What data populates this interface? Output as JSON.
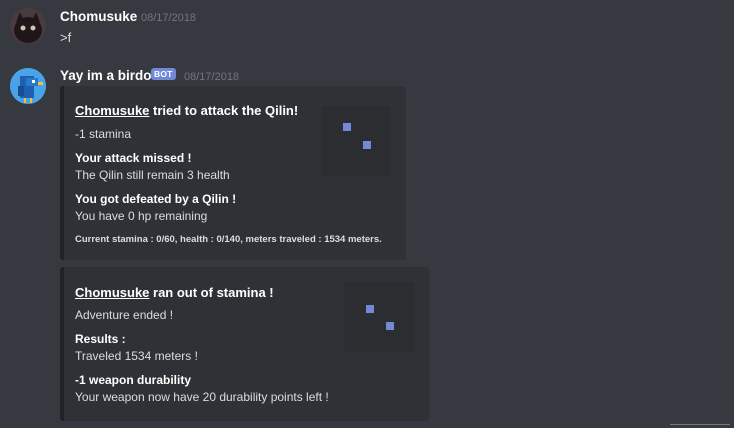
{
  "messages": [
    {
      "username": "Chomusuke",
      "timestamp": "08/17/2018",
      "text": ">f"
    },
    {
      "username": "Yay im a birdo",
      "bot_tag": "BOT",
      "timestamp": "08/17/2018",
      "embeds": [
        {
          "title_user": "Chomusuke",
          "title_rest": " tried to attack the Qilin!",
          "description": "-1 stamina",
          "fields": [
            {
              "name": "Your attack missed !",
              "value": "The Qilin still remain 3 health"
            },
            {
              "name": "You got defeated by a Qilin !",
              "value": "You have 0 hp remaining"
            }
          ],
          "footer": "Current stamina : 0/60, health : 0/140, meters traveled : 1534 meters."
        },
        {
          "title_user": "Chomusuke",
          "title_rest": " ran out of stamina !",
          "description": "Adventure ended !",
          "fields": [
            {
              "name": "Results :",
              "value": "Traveled 1534 meters !"
            },
            {
              "name": "-1 weapon durability",
              "value": "Your weapon now have 20 durability points left !"
            }
          ]
        }
      ]
    }
  ],
  "icons": {
    "user_avatar": "dark-blob-avatar-icon",
    "bot_avatar": "blue-bird-avatar-icon",
    "embed_thumbnail": "qilin-thumbnail-icon"
  },
  "colors": {
    "background": "#36393f",
    "embed_background": "#2f3136",
    "embed_border": "#202225",
    "bot_tag": "#7289da",
    "timestamp": "#72767d"
  }
}
